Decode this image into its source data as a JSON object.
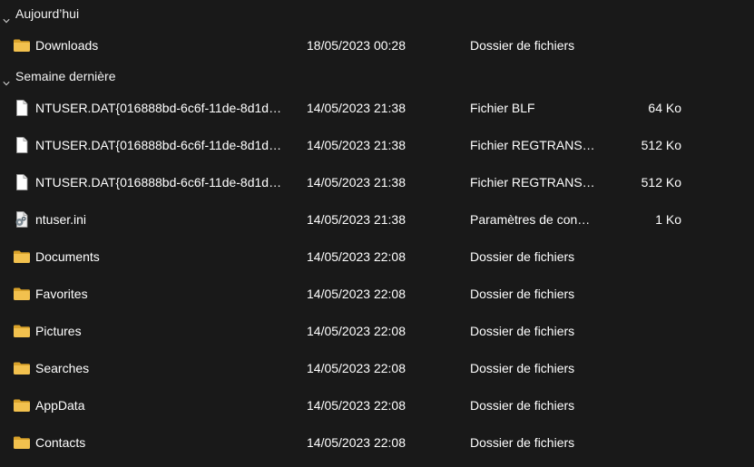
{
  "groups": [
    {
      "label": "Aujourd’hui",
      "items": [
        {
          "name": "Downloads",
          "date": "18/05/2023 00:28",
          "type": "Dossier de fichiers",
          "size": "",
          "icon": "folder-icon"
        }
      ]
    },
    {
      "label": "Semaine dernière",
      "items": [
        {
          "name": "NTUSER.DAT{016888bd-6c6f-11de-8d1d…",
          "date": "14/05/2023 21:38",
          "type": "Fichier BLF",
          "size": "64 Ko",
          "icon": "file-icon"
        },
        {
          "name": "NTUSER.DAT{016888bd-6c6f-11de-8d1d…",
          "date": "14/05/2023 21:38",
          "type": "Fichier REGTRANS…",
          "size": "512 Ko",
          "icon": "file-icon"
        },
        {
          "name": "NTUSER.DAT{016888bd-6c6f-11de-8d1d…",
          "date": "14/05/2023 21:38",
          "type": "Fichier REGTRANS…",
          "size": "512 Ko",
          "icon": "file-icon"
        },
        {
          "name": "ntuser.ini",
          "date": "14/05/2023 21:38",
          "type": "Paramètres de con…",
          "size": "1 Ko",
          "icon": "settings-file-icon"
        },
        {
          "name": "Documents",
          "date": "14/05/2023 22:08",
          "type": "Dossier de fichiers",
          "size": "",
          "icon": "folder-icon"
        },
        {
          "name": "Favorites",
          "date": "14/05/2023 22:08",
          "type": "Dossier de fichiers",
          "size": "",
          "icon": "folder-icon"
        },
        {
          "name": "Pictures",
          "date": "14/05/2023 22:08",
          "type": "Dossier de fichiers",
          "size": "",
          "icon": "folder-icon"
        },
        {
          "name": "Searches",
          "date": "14/05/2023 22:08",
          "type": "Dossier de fichiers",
          "size": "",
          "icon": "folder-icon"
        },
        {
          "name": "AppData",
          "date": "14/05/2023 22:08",
          "type": "Dossier de fichiers",
          "size": "",
          "icon": "folder-icon"
        },
        {
          "name": "Contacts",
          "date": "14/05/2023 22:08",
          "type": "Dossier de fichiers",
          "size": "",
          "icon": "folder-icon"
        }
      ]
    }
  ],
  "colors": {
    "background": "#191919",
    "text": "#ffffff",
    "folder": "#f2c14e",
    "folder_dark": "#d9a22a",
    "file": "#ffffff"
  }
}
